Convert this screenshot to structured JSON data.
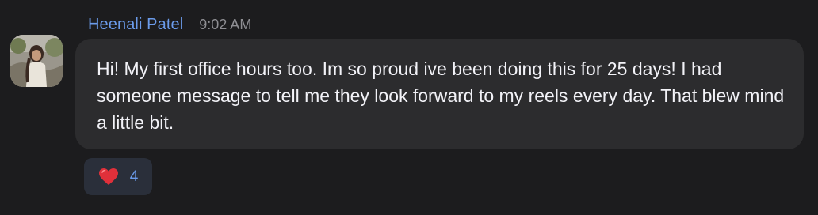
{
  "message": {
    "sender": "Heenali Patel",
    "time": "9:02 AM",
    "text": "Hi! My first office hours too. Im so proud ive been doing this for 25 days! I had someone message to tell me they look forward to my reels every day. That blew mind a little bit."
  },
  "reaction": {
    "icon": "heart-icon",
    "count": "4"
  },
  "colors": {
    "background": "#1c1c1e",
    "bubble": "#2c2c2e",
    "sender_name": "#6b9bea",
    "timestamp": "#8e8e93",
    "text": "#f2f2f7",
    "reaction_bg": "#2a2f3a",
    "heart": "#e0303a"
  }
}
